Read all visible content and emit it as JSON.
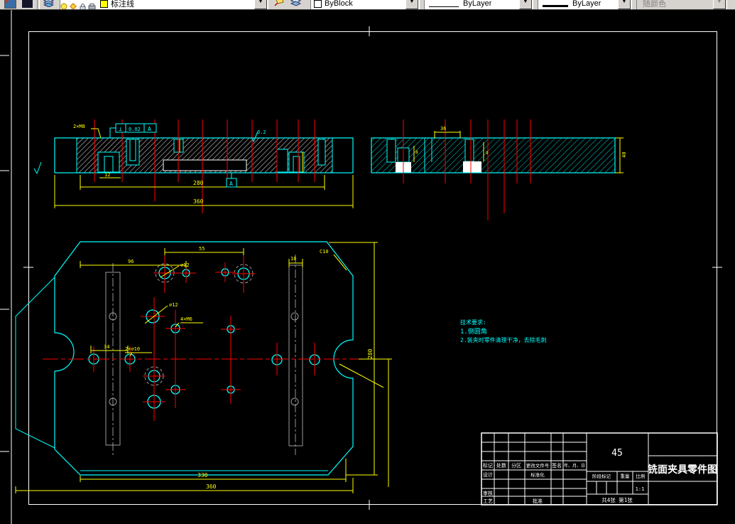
{
  "toolbar": {
    "layer_field": {
      "name": "标注线"
    },
    "color": "ByBlock",
    "linetype": "ByLayer",
    "lineweight": "ByLayer",
    "plot_style": "随颜色"
  },
  "views": {
    "front_section": {
      "dim_inner": "280",
      "dim_outer": "360",
      "leader_thread": "2×M8",
      "fcf_symbol": "⊥",
      "fcf_tolerance": "0.02",
      "fcf_datum": "A",
      "datum_label": "A",
      "roughness": "3.2",
      "dim_pocket": "12"
    },
    "side_section": {
      "dim_top": "36",
      "dim_height": "40",
      "dim_a": "8",
      "dim_b": "9"
    },
    "plan": {
      "dim_width_inner": "330",
      "dim_width_outer": "360",
      "dim_height": "280",
      "dim_a": "96",
      "dim_b": "55",
      "dim_c": "34",
      "dim_slot": "16",
      "leader_1": "∅12",
      "leader_2": "∅12",
      "leader_3": "4×M6",
      "leader_4": "2×∅10",
      "leader_5": "C10"
    }
  },
  "tech_notes": {
    "title": "技术要求:",
    "item1": "1.倒圆角",
    "item2": "2.装夹时零件清理干净，去除毛刺"
  },
  "title_block": {
    "material": "45",
    "drawing_title": "铣面夹具零件图",
    "scale_value": "1:1",
    "sheet_info": "共4张 第1张",
    "stage_label": "阶段标记",
    "weight_label": "重量",
    "scale_label": "比例",
    "col_mark": "标记",
    "col_count": "处数",
    "col_zone": "分区",
    "col_doc": "更改文件号",
    "col_sign": "签名",
    "col_date": "年、月、日",
    "row_design": "设计",
    "row_standard": "标准化",
    "row_check": "审核",
    "row_process": "工艺",
    "row_approve": "批准"
  }
}
